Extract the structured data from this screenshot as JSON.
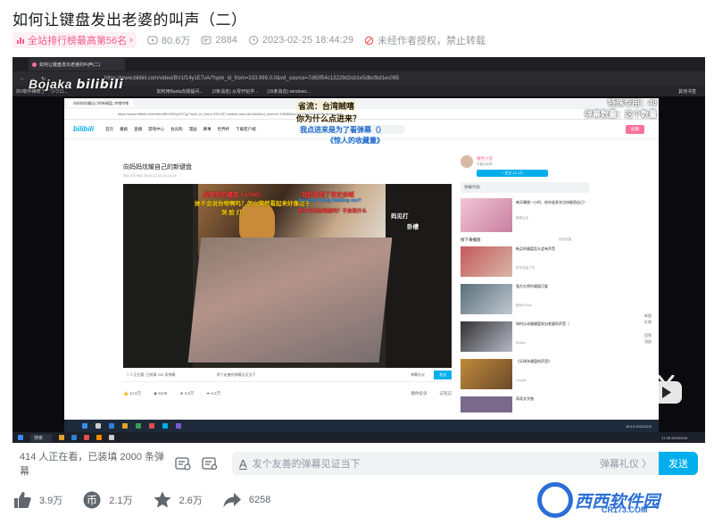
{
  "page": {
    "title": "如何让键盘发出老婆的叫声（二）",
    "rank_label": "全站排行榜最高第56名",
    "views": "80.6万",
    "danmaku": "2884",
    "datetime": "2023-02-25 18:44:29",
    "notice": "未经作者授权，禁止转载"
  },
  "video_frame": {
    "outer_browser_tab": "如何让键盘发出老婆的叫声(二)",
    "outer_url": "https://www.bilibili.com/video/BV1f14y1E7vA/?spm_id_from=333.999.0.0&vd_source=7d63f54c13229d2cb1e5dbcfbd1ec065",
    "bookmarks": [
      "抖9软件推荐了 '' 'つウロ...",
      "如何用Baidu向我提问...",
      "(2条消息) 从零开始学...",
      "(16条消息) windows..."
    ],
    "bookmarks_right": "其他书签",
    "logo_text": "Bojaka",
    "overlay_right_1": "特殊专用：48",
    "overlay_right_2": "弹幕数量：这个数量",
    "caption_1": "省流：台湾贼嘻",
    "caption_2": "你为什么点进来？",
    "caption_3": "我点进来是为了看弹幕（）",
    "caption_4": "《惊人的收藏量》",
    "inner_tab": "向妈妈炫耀自己的新键盘_哔哩哔哩",
    "inner_url": "https://www.bilibili.com/video/BV1fD4y1f7Cg/?spm_id_from=333.337.search-card.all.click&vd_source=7d63f5a4c13229d2cb1e5dbcfbd1ec065",
    "nav_logo": "bilibili",
    "nav_items": [
      "首页",
      "番剧",
      "直播",
      "游戏中心",
      "会员购",
      "漫画",
      "赛事",
      "世界杯",
      "下载客户端"
    ],
    "upload_label": "投稿",
    "inner_video_title": "向妈妈炫耀自己的新键盘",
    "inner_video_meta": "492.4万    942    2020-12-12 21:11:16",
    "danmaku_overlays": [
      "我家狗的键盘（1/100）",
      "我妈看到了肯定会喊",
      "她不会说你啥啊吗？怎么突然看起来好像过于",
      "哭  脸  打",
      "Are you  f king kidding me?",
      "她不会说你键盘吗？不会说什么",
      "妈见打",
      "卧槽"
    ],
    "ctrl_left": "7 人正在看, 已装填 200 条弹幕",
    "ctrl_input": "发个友善的弹幕见证当下",
    "ctrl_etiquette": "弹幕礼仪",
    "ctrl_send": "发送",
    "inner_actions": [
      "14.5万",
      "5449",
      "3.6万",
      "4.2万"
    ],
    "inner_actions_right": [
      "稿件投诉",
      "记笔记"
    ],
    "up_name": "魔性小蛋",
    "up_desc": "不要对我骂",
    "follow_label": "+ 关注 10.1万",
    "danmaku_list_label": "弹幕列表",
    "rec_items": [
      {
        "title": "每天睡搓一小时，给年轻多学点技能而自己！",
        "author": "随缘生活"
      },
      {
        "title": "新买的键盘怎么会有声音",
        "author": "安东尼金了吗"
      },
      {
        "title": "双飞翼最的键盘",
        "author": "小猪"
      },
      {
        "title": "强力大师抄键盘可爱",
        "author": "佛系KYoshi"
      },
      {
        "title": "如何让动键键盘发出老婆的声音（",
        "author": "Bojaka"
      },
      {
        "title": "《天线年键盘的声音》",
        "author": "Inlogue"
      },
      {
        "title": "奇奇文字独",
        "author": ""
      }
    ],
    "continue_label": "接下来播放",
    "autoplay_label": "自动连播",
    "side_right": [
      "新版",
      "反馈",
      "回到",
      "顶部"
    ],
    "tray_time_inner": "15:13 2022/12/2",
    "tray_time_outer": "17:25 2023/2/25",
    "taskbar_search": "搜索"
  },
  "bottom_bar": {
    "watching": "414 人正在看，已装填 2000 条弹幕",
    "input_placeholder": "发个友善的弹幕见证当下",
    "etiquette": "弹幕礼仪 〉",
    "send": "发送"
  },
  "actions": {
    "like": "3.9万",
    "coin": "2.1万",
    "fav": "2.6万",
    "share": "6258"
  },
  "watermark": {
    "brand": "西西软件园",
    "url": "CR173.COM"
  },
  "colors": {
    "accent_blue": "#00aeec",
    "accent_pink": "#fb7299",
    "text_gray": "#9499a0"
  }
}
